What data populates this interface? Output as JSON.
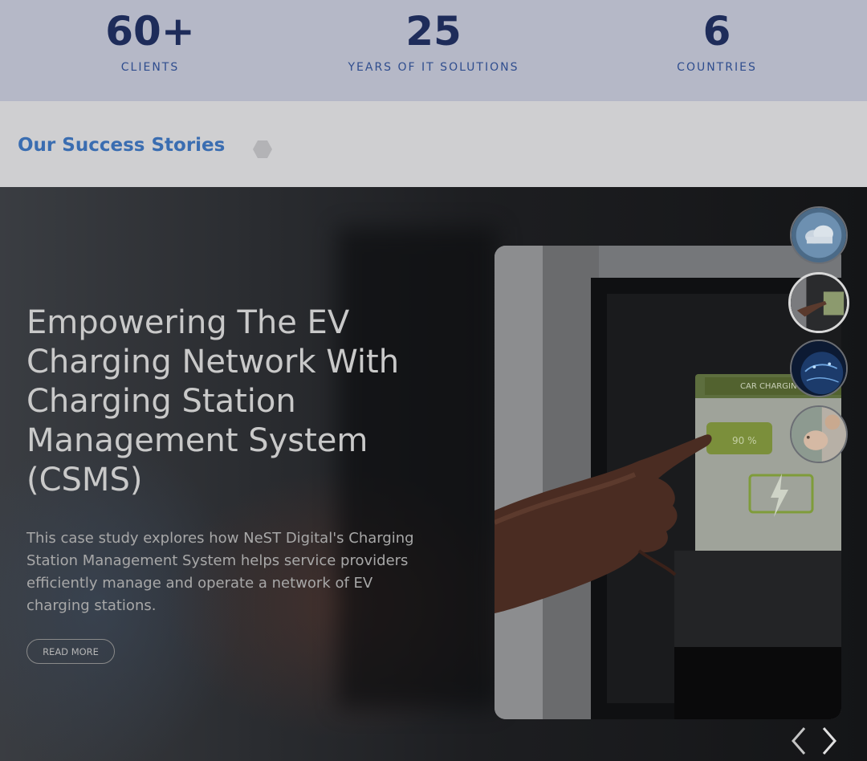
{
  "stats": [
    {
      "value": "60+",
      "label": "CLIENTS"
    },
    {
      "value": "25",
      "label": "YEARS OF IT SOLUTIONS"
    },
    {
      "value": "6",
      "label": "COUNTRIES"
    }
  ],
  "section": {
    "title": "Our Success Stories",
    "icon": "hexagon-icon"
  },
  "slide": {
    "title": "Empowering The EV Charging Network With Charging Station Management System (CSMS)",
    "description": "This case study explores how NeST Digital's Charging Station Management System helps service providers efficiently manage and operate a network of EV charging stations.",
    "button_label": "READ MORE",
    "image": {
      "screen_header": "CAR CHARGING",
      "charge_level": "90 %",
      "icon": "lightning-bolt-icon"
    }
  },
  "thumbnails": [
    {
      "name": "cloud-network-thumbnail",
      "active": false
    },
    {
      "name": "ev-charging-thumbnail",
      "active": true
    },
    {
      "name": "earth-network-thumbnail",
      "active": false
    },
    {
      "name": "piggy-bank-thumbnail",
      "active": false
    }
  ],
  "navigation": {
    "prev_icon": "chevron-left-icon",
    "next_icon": "chevron-right-icon"
  },
  "colors": {
    "stats_background": "#b5b8c7",
    "stat_value": "#1e2c5a",
    "stat_label": "#2f4d8e",
    "section_title": "#3a6db1",
    "section_background": "#cfcfd1"
  }
}
